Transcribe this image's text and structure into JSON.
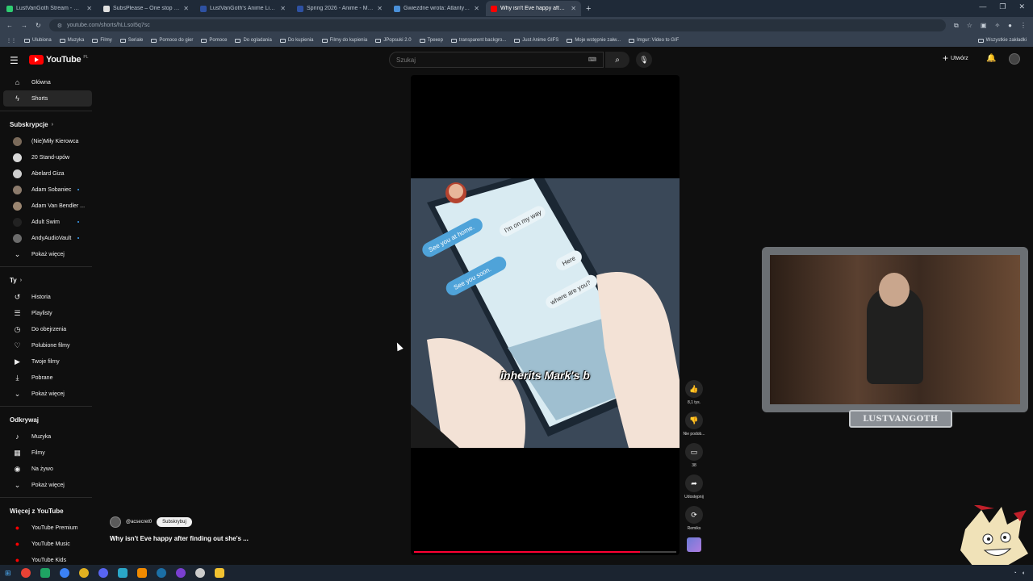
{
  "browser": {
    "tabs": [
      {
        "title": "LustVanGoth Stream - Watch L",
        "color": "#2ecc71",
        "active": false
      },
      {
        "title": "SubsPlease – One stop shop fo",
        "color": "#e0e0e0",
        "active": false
      },
      {
        "title": "LustVanGoth's Anime List - My",
        "color": "#2e51a2",
        "active": false
      },
      {
        "title": "Spring 2026 - Anime - MyAnim",
        "color": "#2e51a2",
        "active": false
      },
      {
        "title": "Gwiezdne wrota: Atlantyda / St",
        "color": "#4a90d9",
        "active": false
      },
      {
        "title": "Why isn't Eve happy after fi",
        "color": "#ff0000",
        "active": true
      }
    ],
    "url": "youtube.com/shorts/hLLsoI5q7sc",
    "bookmarks": [
      "Ulubiona",
      "Muzyka",
      "Filmy",
      "Seriale",
      "Pomoce do gier",
      "Pomoce",
      "Do ogladania",
      "Do kupienia",
      "Filmy do kupienia",
      "JPopsuki 2.0",
      "Трекер",
      "transparent backgro...",
      "Just Anime GIFS",
      "Moje wstępnie załw...",
      "Imgur: Video to GIF"
    ],
    "bookmarks_right": "Wszystkie zakładki"
  },
  "masthead": {
    "logo": "YouTube",
    "country": "PL",
    "search_placeholder": "Szukaj",
    "create_label": "Utwórz"
  },
  "sidebar": {
    "main": [
      {
        "label": "Główna",
        "icon": "home-icon",
        "glyph": "⌂"
      },
      {
        "label": "Shorts",
        "icon": "shorts-icon",
        "glyph": "ϟ",
        "active": true
      }
    ],
    "subs_heading": "Subskrypcje",
    "subs": [
      {
        "label": "(Nie)Miły Kierowca",
        "color": "#7a6a5a",
        "dot": false
      },
      {
        "label": "20 Stand-upów",
        "color": "#d8d8d8",
        "dot": false
      },
      {
        "label": "Abelard Giza",
        "color": "#cfcfcf",
        "dot": false
      },
      {
        "label": "Adam Sobaniec",
        "color": "#8c7b6c",
        "dot": true
      },
      {
        "label": "Adam Van Bendler ...",
        "color": "#9a8570",
        "dot": false
      },
      {
        "label": "Adult Swim",
        "color": "#222222",
        "dot": true
      },
      {
        "label": "AndyAudioVault",
        "color": "#6b6b6b",
        "dot": true
      }
    ],
    "subs_more": "Pokaż więcej",
    "you_heading": "Ty",
    "you": [
      {
        "label": "Historia",
        "glyph": "↺"
      },
      {
        "label": "Playlisty",
        "glyph": "☰"
      },
      {
        "label": "Do obejrzenia",
        "glyph": "◷"
      },
      {
        "label": "Polubione filmy",
        "glyph": "♡"
      },
      {
        "label": "Twoje filmy",
        "glyph": "▶"
      },
      {
        "label": "Pobrane",
        "glyph": "⤓"
      }
    ],
    "you_more": "Pokaż więcej",
    "explore_heading": "Odkrywaj",
    "explore": [
      {
        "label": "Muzyka",
        "glyph": "♪"
      },
      {
        "label": "Filmy",
        "glyph": "▦"
      },
      {
        "label": "Na żywo",
        "glyph": "◉"
      }
    ],
    "explore_more": "Pokaż więcej",
    "more_heading": "Więcej z YouTube",
    "more": [
      {
        "label": "YouTube Premium"
      },
      {
        "label": "YouTube Music"
      },
      {
        "label": "YouTube Kids"
      }
    ]
  },
  "short": {
    "caption": "inherits Mark's b",
    "progress": 0.86,
    "phone_bubbles": [
      "See you at home.",
      "I'm on my way",
      "See you soon.",
      "Here",
      "where are you?"
    ],
    "channel": "@acsecret0",
    "subscribe": "Subskrybuj",
    "title": "Why isn't Eve happy after finding out she's ..."
  },
  "actions": {
    "like_count": "8,1 tys.",
    "dislike_label": "Nie podob...",
    "comments": "38",
    "share": "Udostępnij",
    "remix": "Remiks"
  },
  "overlay": {
    "nameplate": "LUSTVANGOTH"
  },
  "colors": {
    "youtube_red": "#ff0000",
    "progress_red": "#ff0033",
    "accent_blue": "#3ea6ff"
  }
}
